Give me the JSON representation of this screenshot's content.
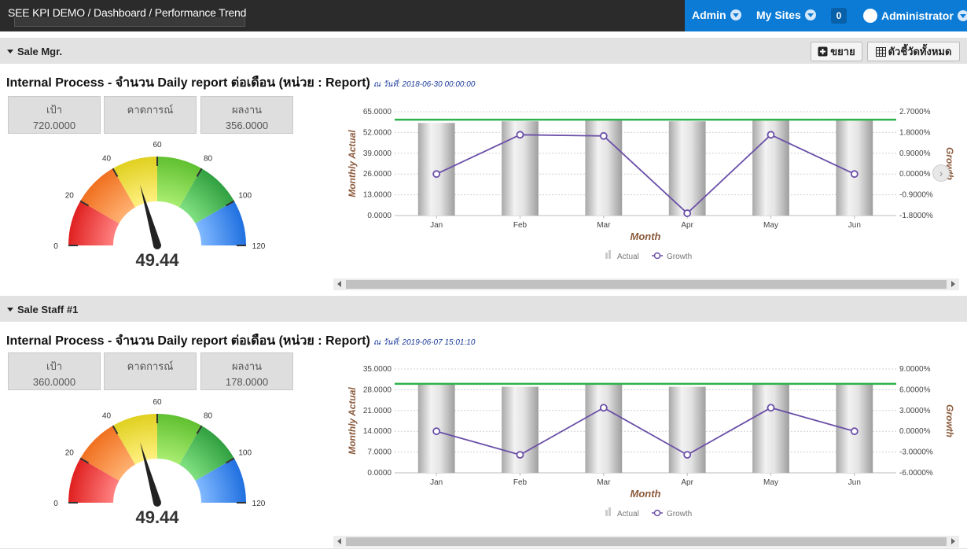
{
  "topbar": {
    "breadcrumb": "SEE KPI DEMO / Dashboard / Performance Trend",
    "nav": {
      "admin": "Admin",
      "my_sites": "My Sites",
      "count": "0",
      "user": "Administrator"
    }
  },
  "colors": {
    "brand_blue": "#0b7bd6",
    "target_line": "#2db34a",
    "growth_line": "#6a4fa8",
    "axis_title": "#8b5a3c"
  },
  "panels": [
    {
      "header": "Sale Mgr.",
      "kpi_title": "Internal Process - จำนวน Daily report ต่อเดือน (หน่วย : Report)",
      "as_of": "ณ วันที่: 2018-06-30 00:00:00",
      "boxes": [
        {
          "label": "เป้า",
          "value": "720.0000"
        },
        {
          "label": "คาดการณ์",
          "value": ""
        },
        {
          "label": "ผลงาน",
          "value": "356.0000"
        }
      ],
      "gauge": {
        "value": 49.44,
        "display": "49.44",
        "min": 0,
        "max": 120,
        "ticks": [
          "0",
          "20",
          "40",
          "60",
          "80",
          "100",
          "120"
        ]
      }
    },
    {
      "header": "Sale Staff #1",
      "kpi_title": "Internal Process - จำนวน Daily report ต่อเดือน (หน่วย : Report)",
      "as_of": "ณ วันที่: 2019-06-07 15:01:10",
      "boxes": [
        {
          "label": "เป้า",
          "value": "360.0000"
        },
        {
          "label": "คาดการณ์",
          "value": ""
        },
        {
          "label": "ผลงาน",
          "value": "178.0000"
        }
      ],
      "gauge": {
        "value": 49.44,
        "display": "49.44",
        "min": 0,
        "max": 120,
        "ticks": [
          "0",
          "20",
          "40",
          "60",
          "80",
          "100",
          "120"
        ]
      }
    }
  ],
  "buttons": {
    "expand": "ขยาย",
    "all_kpi": "ตัวชี้วัดทั้งหมด"
  },
  "chart_data": [
    {
      "type": "bar",
      "categories": [
        "Jan",
        "Feb",
        "Mar",
        "Apr",
        "May",
        "Jun"
      ],
      "series": [
        {
          "name": "Actual",
          "type": "bar",
          "axis": "left",
          "values": [
            58,
            59,
            60,
            59,
            60,
            60
          ]
        },
        {
          "name": "Growth",
          "type": "line",
          "axis": "right",
          "values": [
            0.0,
            1.7,
            1.65,
            -1.7,
            1.7,
            0.0
          ]
        }
      ],
      "target": 60,
      "xlabel": "Month",
      "ylabel": "Monthly Actual",
      "y2label": "Growth",
      "ylim": [
        0,
        65
      ],
      "y2lim": [
        -1.8,
        2.7
      ],
      "yticks": [
        "0.0000",
        "13.0000",
        "26.0000",
        "39.0000",
        "52.0000",
        "65.0000"
      ],
      "y2ticks": [
        "-1.8000%",
        "-0.9000%",
        "0.0000%",
        "0.9000%",
        "1.8000%",
        "2.7000%"
      ],
      "legend": [
        "Actual",
        "Growth"
      ],
      "legend_position": "bottom"
    },
    {
      "type": "bar",
      "categories": [
        "Jan",
        "Feb",
        "Mar",
        "Apr",
        "May",
        "Jun"
      ],
      "series": [
        {
          "name": "Actual",
          "type": "bar",
          "axis": "left",
          "values": [
            30,
            29,
            30,
            29,
            30,
            30
          ]
        },
        {
          "name": "Growth",
          "type": "line",
          "axis": "right",
          "values": [
            0.0,
            -3.4,
            3.4,
            -3.4,
            3.4,
            0.0
          ]
        }
      ],
      "target": 30,
      "xlabel": "Month",
      "ylabel": "Monthly Actual",
      "y2label": "Growth",
      "ylim": [
        0,
        35
      ],
      "y2lim": [
        -6,
        9
      ],
      "yticks": [
        "0.0000",
        "7.0000",
        "14.0000",
        "21.0000",
        "28.0000",
        "35.0000"
      ],
      "y2ticks": [
        "-6.0000%",
        "-3.0000%",
        "0.0000%",
        "3.0000%",
        "6.0000%",
        "9.0000%"
      ],
      "legend": [
        "Actual",
        "Growth"
      ],
      "legend_position": "bottom"
    }
  ]
}
